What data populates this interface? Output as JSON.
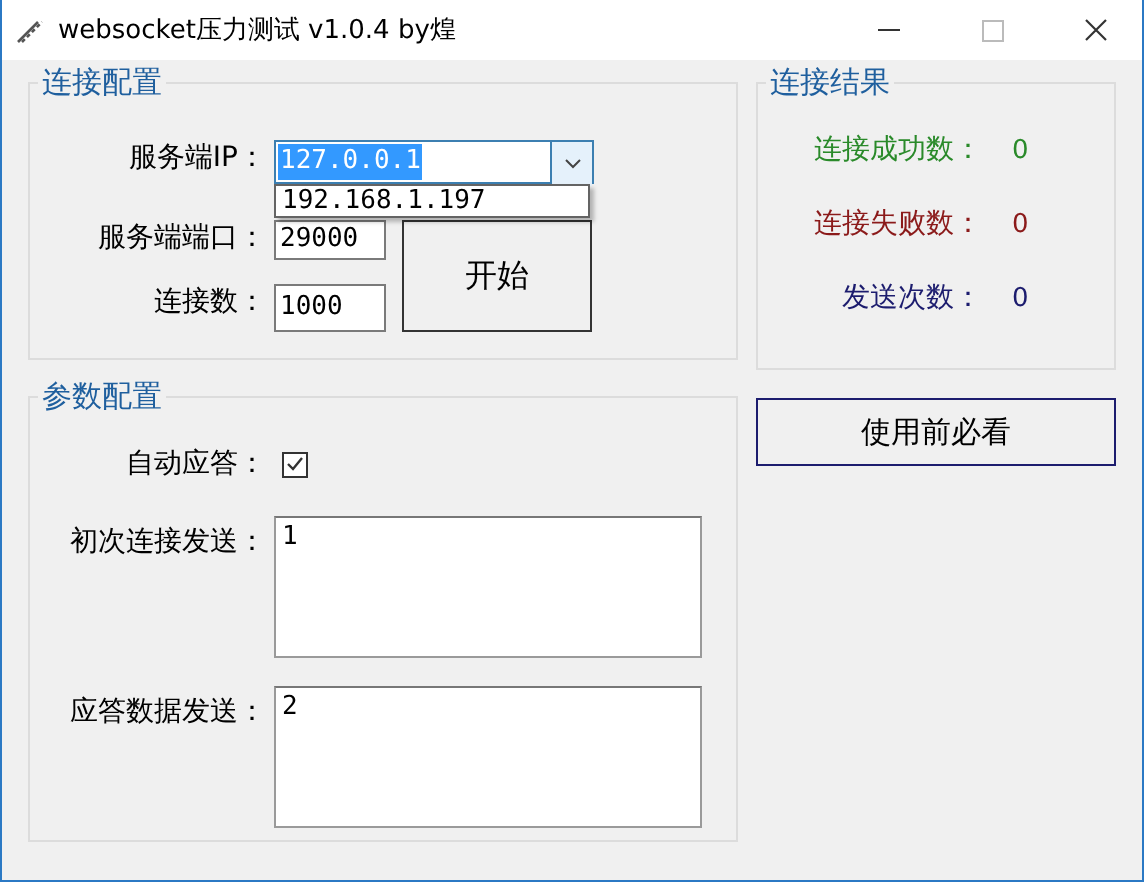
{
  "window": {
    "title": "websocket压力测试 v1.0.4 by煌"
  },
  "connection_config": {
    "title": "连接配置",
    "server_ip": {
      "label": "服务端IP：",
      "value": "127.0.0.1",
      "expanded": true,
      "options": [
        "192.168.1.197"
      ]
    },
    "server_port": {
      "label": "服务端端口：",
      "value": "29000"
    },
    "connections": {
      "label": "连接数：",
      "value": "1000"
    },
    "start_button": "开始"
  },
  "connection_results": {
    "title": "连接结果",
    "items": [
      {
        "label": "连接成功数：",
        "value": "0",
        "color": "#2a8a2a"
      },
      {
        "label": "连接失败数：",
        "value": "0",
        "color": "#8b1a1a"
      },
      {
        "label": "发送次数：",
        "value": "0",
        "color": "#1c1c6e"
      }
    ]
  },
  "help_button": "使用前必看",
  "parameter_config": {
    "title": "参数配置",
    "auto_reply": {
      "label": "自动应答：",
      "checked": true
    },
    "fields": [
      {
        "label": "初次连接发送：",
        "value": "1"
      },
      {
        "label": "应答数据发送：",
        "value": "2"
      }
    ]
  }
}
